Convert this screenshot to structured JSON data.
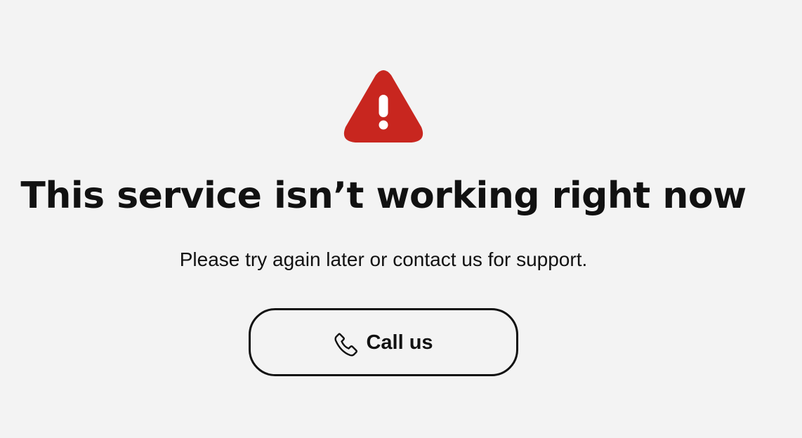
{
  "alert": {
    "icon": "warning-triangle-icon",
    "icon_color": "#c8261f",
    "title": "This service isn’t working right now",
    "message": "Please try again later or contact us for support."
  },
  "actions": {
    "call": {
      "label": "Call us",
      "icon": "phone-icon"
    }
  },
  "colors": {
    "background": "#f3f3f3",
    "text": "#111111",
    "accent": "#c8261f"
  }
}
